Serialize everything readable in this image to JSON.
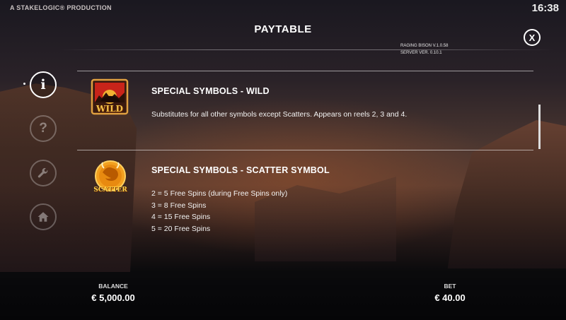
{
  "header": {
    "producer": "A STAKELOGIC® PRODUCTION",
    "time": "16:38",
    "title": "PAYTABLE",
    "version_game": "RAGING BISON V.1.0.58",
    "version_server": "SERVER VER. 0.10.1",
    "close_label": "X"
  },
  "nav": {
    "info_glyph": "i",
    "help_glyph": "?",
    "settings_glyph": "wrench",
    "home_glyph": "home"
  },
  "sections": {
    "wild": {
      "title": "SPECIAL SYMBOLS - WILD",
      "symbol_label": "WILD",
      "description": "Substitutes for all other symbols except Scatters. Appears on reels 2, 3 and 4."
    },
    "scatter": {
      "title": "SPECIAL SYMBOLS - SCATTER SYMBOL",
      "symbol_label": "SCATTER",
      "lines": [
        "2 = 5 Free Spins (during Free Spins only)",
        "3 = 8 Free Spins",
        "4 = 15 Free Spins",
        "5 = 20 Free Spins"
      ]
    }
  },
  "footer": {
    "balance_label": "BALANCE",
    "balance_value": "€ 5,000.00",
    "bet_label": "BET",
    "bet_value": "€ 40.00"
  },
  "colors": {
    "accent_gold": "#f2b233",
    "wild_red": "#c8241a"
  }
}
